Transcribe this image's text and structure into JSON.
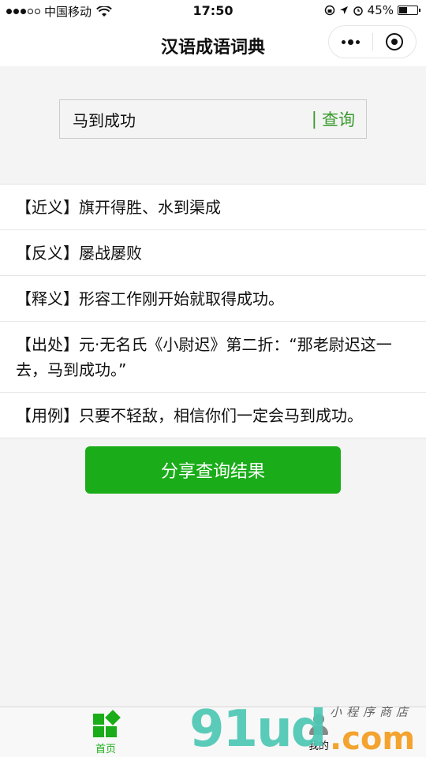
{
  "status_bar": {
    "carrier": "中国移动",
    "time": "17:50",
    "battery": "45%",
    "battery_level": 0.45,
    "signal_icon": "signal-dots-icon",
    "wifi_icon": "wifi-icon"
  },
  "nav": {
    "title": "汉语成语词典",
    "more_icon": "more-dots-icon",
    "close_icon": "target-icon"
  },
  "search": {
    "value": "马到成功",
    "separator": "|",
    "button_label": "查询"
  },
  "results": [
    {
      "label": "【近义】",
      "text": "旗开得胜、水到渠成"
    },
    {
      "label": "【反义】",
      "text": "屡战屡败"
    },
    {
      "label": "【释义】",
      "text": "形容工作刚开始就取得成功。"
    },
    {
      "label": "【出处】",
      "text": "元·无名氏《小尉迟》第二折：“那老尉迟这一去，马到成功。”"
    },
    {
      "label": "【用例】",
      "text": "只要不轻敌，相信你们一定会马到成功。"
    }
  ],
  "share_button": "分享查询结果",
  "tabs": [
    {
      "label": "首页",
      "icon": "home-icon",
      "active": true
    },
    {
      "label": "我的",
      "icon": "user-icon",
      "active": false
    }
  ],
  "watermark": {
    "logo": "91ud",
    "suffix": ".com",
    "subtitle": "小程序商店"
  },
  "colors": {
    "accent": "#1aad19",
    "link": "#3a9b2f",
    "background": "#f4f4f4"
  }
}
